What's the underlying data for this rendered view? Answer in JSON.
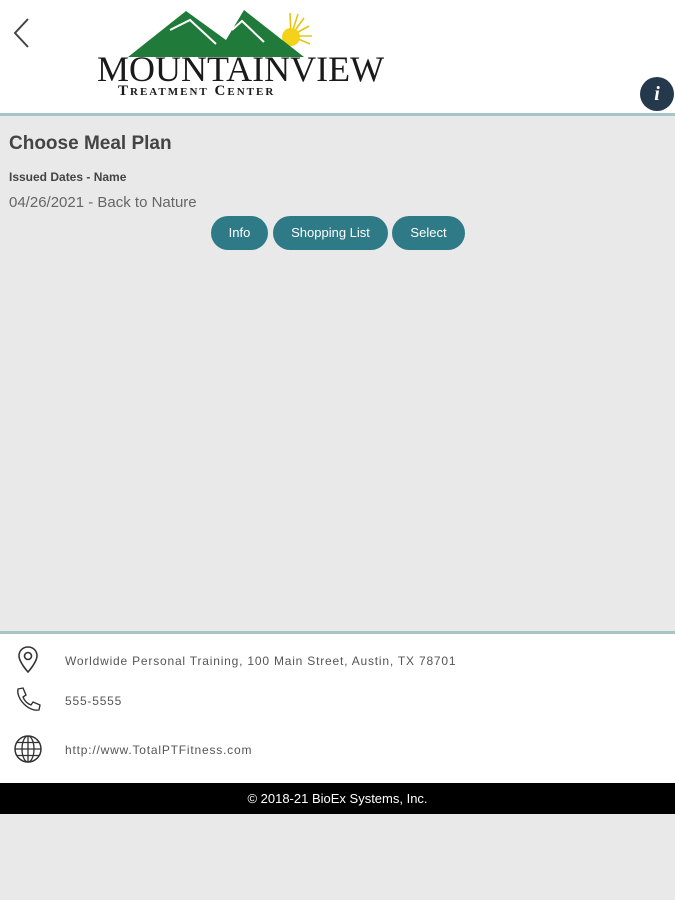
{
  "header": {
    "logo": {
      "word_first": "M",
      "word_rest": "OUNTAINVIEW",
      "sub_t": "T",
      "sub_reatment": "REATMENT",
      "sub_c": "C",
      "sub_enter": "ENTER"
    },
    "info_label": "i"
  },
  "main": {
    "title": "Choose Meal Plan",
    "column_label": "Issued Dates - Name",
    "plan": "04/26/2021 - Back to Nature",
    "buttons": {
      "info": "Info",
      "shopping_list": "Shopping List",
      "select": "Select"
    }
  },
  "footer": {
    "address": "Worldwide Personal Training, 100 Main Street, Austin, TX 78701",
    "phone": "555-5555",
    "website": "http://www.TotalPTFitness.com",
    "copyright": "© 2018-21 BioEx Systems, Inc."
  },
  "icons": {
    "back": "chevron-left-icon",
    "location": "map-pin-icon",
    "phone": "phone-icon",
    "web": "globe-icon"
  },
  "colors": {
    "accent": "#2e7b87",
    "info_button": "#243a4c",
    "logo_green": "#207a3a",
    "divider": "#a7c4c6"
  }
}
